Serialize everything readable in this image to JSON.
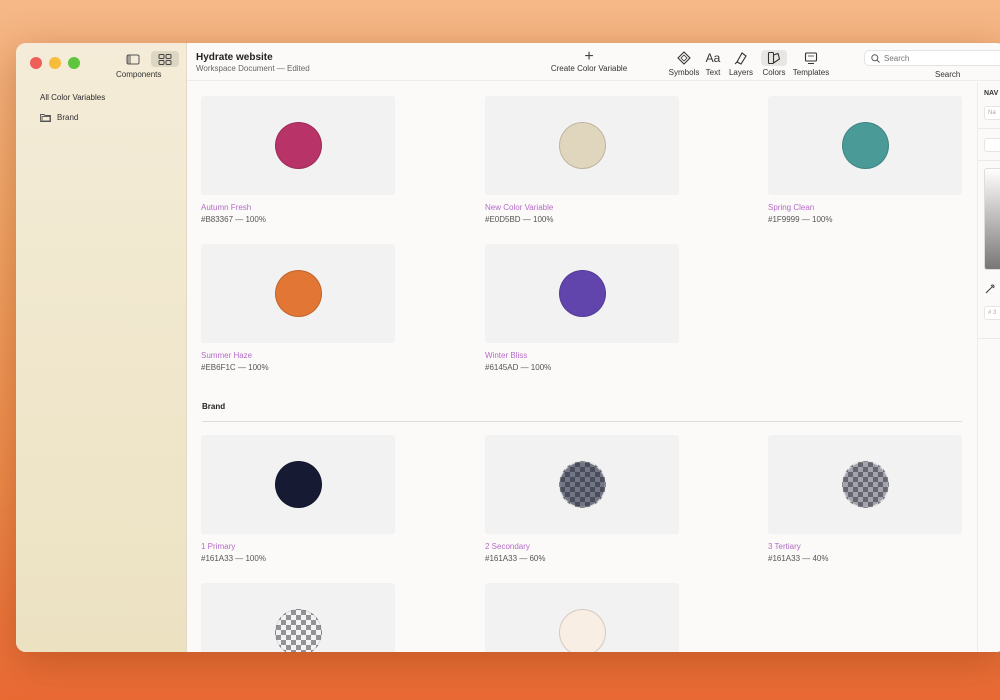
{
  "window": {
    "title": "Hydrate website",
    "subtitle": "Workspace Document — Edited"
  },
  "sidebar": {
    "caption": "Components",
    "heading": "All Color Variables",
    "items": [
      {
        "label": "Brand",
        "icon": "folder-icon"
      }
    ]
  },
  "toolbar": {
    "create_label": "Create Color Variable",
    "tools": [
      {
        "label": "Symbols",
        "icon": "symbols-icon"
      },
      {
        "label": "Text",
        "icon": "text-icon"
      },
      {
        "label": "Layers",
        "icon": "layers-icon"
      },
      {
        "label": "Colors",
        "icon": "colors-icon",
        "active": true
      },
      {
        "label": "Templates",
        "icon": "templates-icon"
      }
    ],
    "search_placeholder": "Search",
    "search_label": "Search"
  },
  "colors": [
    {
      "name": "Autumn Fresh",
      "meta": "#B83367 — 100%",
      "hex": "#B83367",
      "opacity": 1
    },
    {
      "name": "New Color Variable",
      "meta": "#E0D5BD — 100%",
      "hex": "#E0D5BD",
      "opacity": 1
    },
    {
      "name": "Spring Clean",
      "meta": "#1F9999 — 100%",
      "hex": "#4A9A98",
      "opacity": 1
    },
    {
      "name": "Summer Haze",
      "meta": "#EB6F1C — 100%",
      "hex": "#E27634",
      "opacity": 1
    },
    {
      "name": "Winter Bliss",
      "meta": "#6145AD — 100%",
      "hex": "#6145AD",
      "opacity": 1
    }
  ],
  "brand_section": {
    "title": "Brand",
    "colors": [
      {
        "name": "1 Primary",
        "meta": "#161A33 — 100%",
        "hex": "#161A33",
        "opacity": 1
      },
      {
        "name": "2 Secondary",
        "meta": "#161A33 — 60%",
        "hex": "#161A33",
        "opacity": 0.6
      },
      {
        "name": "3 Tertiary",
        "meta": "#161A33 — 40%",
        "hex": "#161A33",
        "opacity": 0.4
      },
      {
        "name": "",
        "meta": "",
        "hex": "#161A33",
        "opacity": 0.1
      },
      {
        "name": "",
        "meta": "",
        "hex": "#F8EEE4",
        "opacity": 1
      }
    ]
  },
  "inspector": {
    "label": "NAV",
    "name_placeholder": "Na",
    "hex_placeholder": "# 3"
  }
}
